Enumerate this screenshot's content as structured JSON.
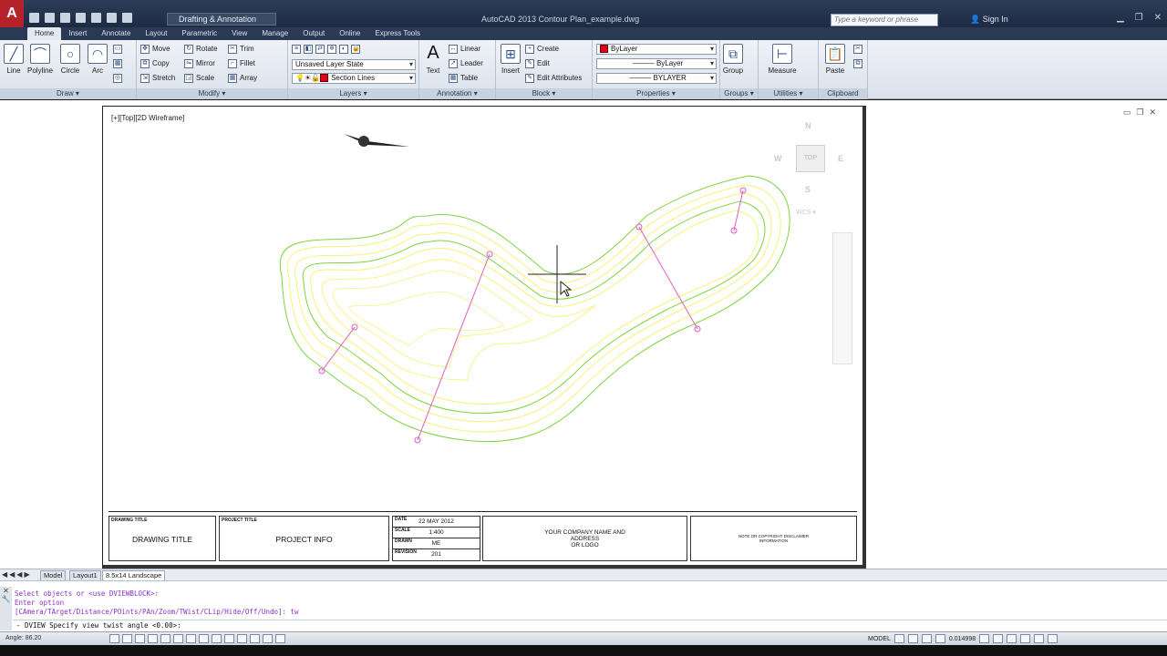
{
  "titlebar": {
    "workspace": "Drafting & Annotation",
    "window_title": "AutoCAD 2013    Contour Plan_example.dwg",
    "search_placeholder": "Type a keyword or phrase",
    "signin": "Sign In"
  },
  "tabs": [
    "Home",
    "Insert",
    "Annotate",
    "Layout",
    "Parametric",
    "View",
    "Manage",
    "Output",
    "Online",
    "Express Tools"
  ],
  "active_tab": "Home",
  "ribbon": {
    "draw": {
      "title": "Draw",
      "line": "Line",
      "polyline": "Polyline",
      "circle": "Circle",
      "arc": "Arc"
    },
    "modify": {
      "title": "Modify",
      "move": "Move",
      "rotate": "Rotate",
      "trim": "Trim",
      "copy": "Copy",
      "mirror": "Mirror",
      "fillet": "Fillet",
      "stretch": "Stretch",
      "scale": "Scale",
      "array": "Array"
    },
    "layers": {
      "title": "Layers",
      "layer_state": "Unsaved Layer State",
      "current_layer": "Section Lines"
    },
    "annotation": {
      "title": "Annotation",
      "text": "Text",
      "linear": "Linear",
      "leader": "Leader",
      "table": "Table"
    },
    "block": {
      "title": "Block",
      "insert": "Insert",
      "create": "Create",
      "edit": "Edit",
      "edit_attributes": "Edit Attributes"
    },
    "properties": {
      "title": "Properties",
      "color": "ByLayer",
      "linetype": "ByLayer",
      "lineweight": "BYLAYER"
    },
    "groups": {
      "title": "Groups",
      "group": "Group"
    },
    "utilities": {
      "title": "Utilities",
      "measure": "Measure"
    },
    "clipboard": {
      "title": "Clipboard",
      "paste": "Paste"
    }
  },
  "viewport": {
    "label": "[+][Top][2D Wireframe]",
    "compass": {
      "n": "N",
      "s": "S",
      "e": "E",
      "w": "W"
    },
    "cube_face": "TOP",
    "wcs": "WCS ▾"
  },
  "titleblock": {
    "drawing_title_caption": "DRAWING TITLE",
    "drawing_title": "DRAWING TITLE",
    "project_title_caption": "PROJECT TITLE",
    "project_title": "PROJECT INFO",
    "date_caption": "DATE",
    "date": "22  MAY  2012",
    "scale_caption": "SCALE",
    "scale": "1:400",
    "drawn_caption": "DRAWN",
    "drawn": "ME",
    "revision_caption": "REVISION",
    "revision": "201",
    "company_line1": "YOUR COMPANY NAME AND",
    "company_line2": "ADDRESS",
    "company_line3": "OR LOGO",
    "note_line1": "NOTE OR COPYRIGHT DISCLAIMER",
    "note_line2": "INFORMATION"
  },
  "layout_tabs": [
    "Model",
    "Layout1",
    "8.5x14 Landscape"
  ],
  "active_layout": "8.5x14 Landscape",
  "command": {
    "history": [
      "Select objects or <use DVIEWBLOCK>:",
      "Enter option",
      "[CAmera/TArget/Distance/POints/PAn/Zoom/TWist/CLip/Hide/Off/Undo]: tw"
    ],
    "prompt": "- DVIEW Specify view twist angle <0.00>:"
  },
  "status": {
    "coords": "Angle: 86.20",
    "mode": "MODEL",
    "scale": "0.014998"
  },
  "colors": {
    "contour_yellow": "#f4f27a",
    "contour_green": "#7fd33b",
    "section_magenta": "#e05cc4"
  }
}
